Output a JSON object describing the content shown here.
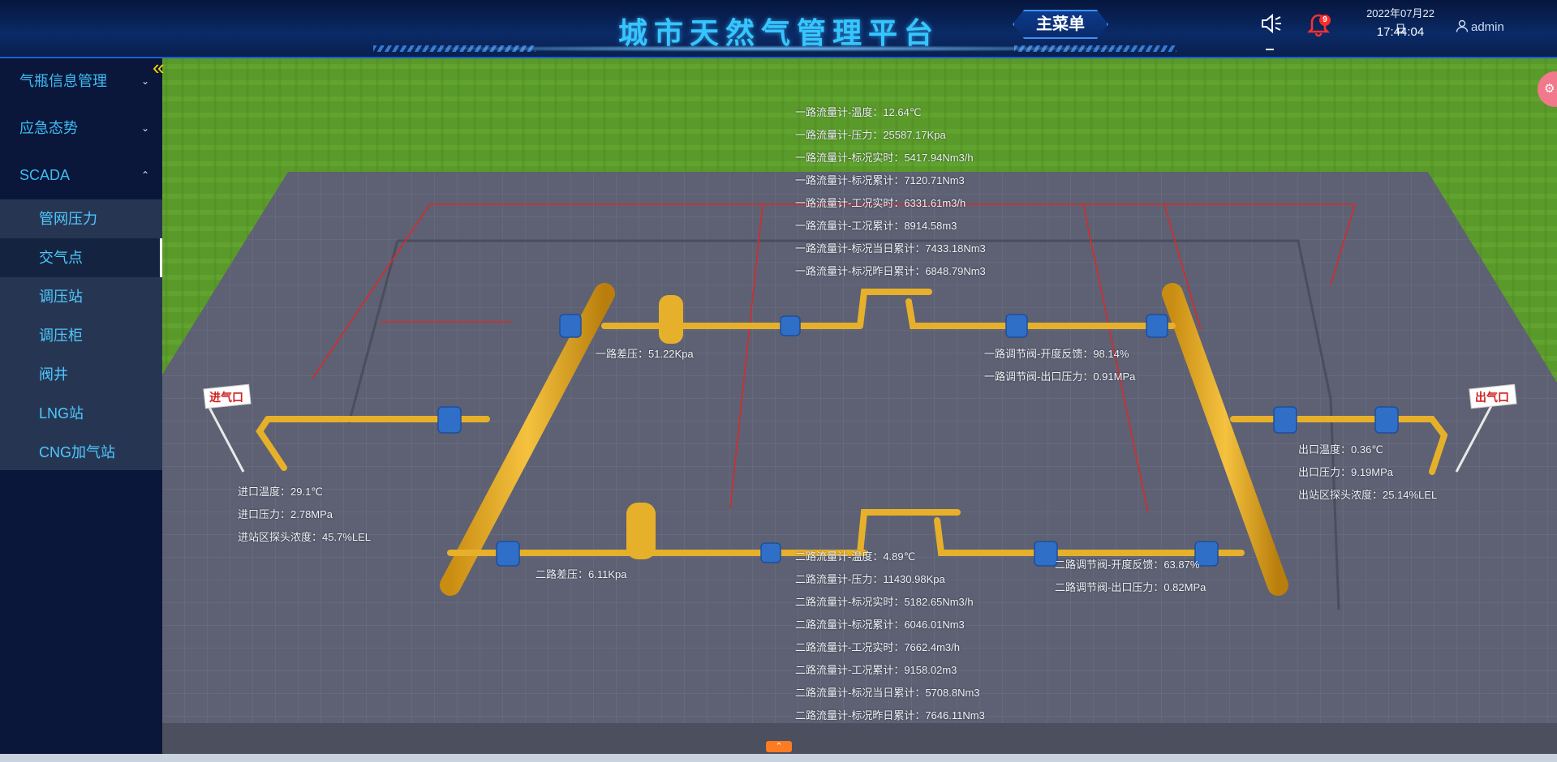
{
  "header": {
    "title": "城市天然气管理平台",
    "main_menu_label": "主菜单",
    "notification_count": "9",
    "date": "2022年07月22日",
    "time": "17:44:04",
    "user": "admin"
  },
  "sidebar": {
    "top_items": [
      {
        "label": "气瓶信息管理",
        "expanded": false
      },
      {
        "label": "应急态势",
        "expanded": false
      },
      {
        "label": "SCADA",
        "expanded": true
      }
    ],
    "sub_items": [
      {
        "label": "管网压力"
      },
      {
        "label": "交气点",
        "active": true
      },
      {
        "label": "调压站"
      },
      {
        "label": "调压柜"
      },
      {
        "label": "阀井"
      },
      {
        "label": "LNG站"
      },
      {
        "label": "CNG加气站"
      }
    ]
  },
  "scene": {
    "inlet_sign": "进气口",
    "outlet_sign": "出气口",
    "line1_flow": [
      "一路流量计-温度：12.64℃",
      "一路流量计-压力：25587.17Kpa",
      "一路流量计-标况实时：5417.94Nm3/h",
      "一路流量计-标况累计：7120.71Nm3",
      "一路流量计-工况实时：6331.61m3/h",
      "一路流量计-工况累计：8914.58m3",
      "一路流量计-标况当日累计：7433.18Nm3",
      "一路流量计-标况昨日累计：6848.79Nm3"
    ],
    "line1_diff": "一路差压：51.22Kpa",
    "line1_reg": [
      "一路调节阀-开度反馈：98.14%",
      "一路调节阀-出口压力：0.91MPa"
    ],
    "inlet": [
      "进口温度：29.1℃",
      "进口压力：2.78MPa",
      "进站区探头浓度：45.7%LEL"
    ],
    "outlet": [
      "出口温度：0.36℃",
      "出口压力：9.19MPa",
      "出站区探头浓度：25.14%LEL"
    ],
    "line2_diff": "二路差压：6.11Kpa",
    "line2_flow": [
      "二路流量计-温度：4.89℃",
      "二路流量计-压力：11430.98Kpa",
      "二路流量计-标况实时：5182.65Nm3/h",
      "二路流量计-标况累计：6046.01Nm3",
      "二路流量计-工况实时：7662.4m3/h",
      "二路流量计-工况累计：9158.02m3",
      "二路流量计-标况当日累计：5708.8Nm3",
      "二路流量计-标况昨日累计：7646.11Nm3"
    ],
    "line2_reg": [
      "二路调节阀-开度反馈：63.87%",
      "二路调节阀-出口压力：0.82MPa"
    ]
  }
}
